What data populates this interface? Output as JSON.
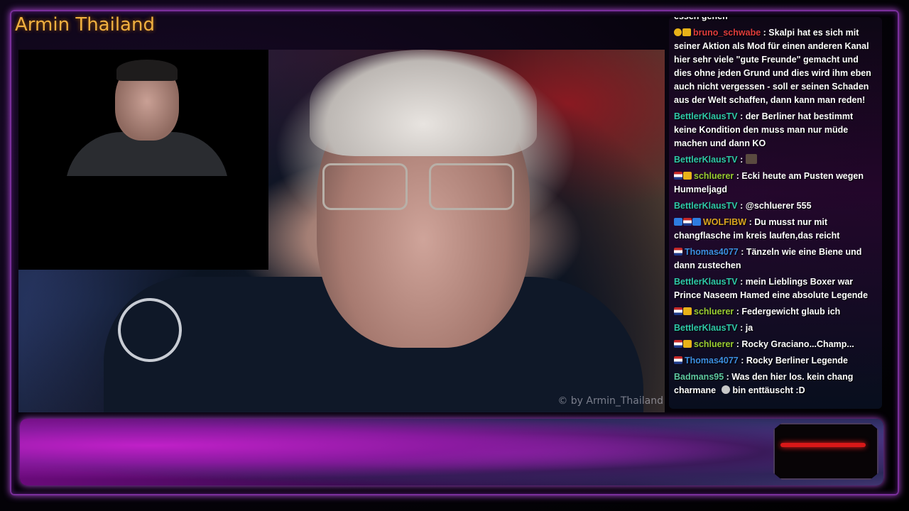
{
  "stream": {
    "title": "Armin Thailand",
    "watermark": "© by Armin_Thailand"
  },
  "colors": {
    "title": "#f0b040",
    "frame_border": "#7a2f9b"
  },
  "chat": {
    "partial_top": "essen gehen",
    "messages": [
      {
        "badges": [
          "warn-badge",
          "gold-badge"
        ],
        "user": "bruno_schwabe",
        "color": "#e03c3c",
        "text": ": Skalpi hat es sich mit seiner Aktion als Mod für einen anderen Kanal hier sehr viele \"gute Freunde\" gemacht und dies ohne jeden Grund und dies wird ihm eben auch nicht vergessen - soll er seinen Schaden aus der Welt schaffen, dann kann man reden!"
      },
      {
        "badges": [],
        "user": "BettlerKlausTV",
        "color": "#2fc9a8",
        "text": ": der Berliner hat bestimmt keine Kondition den muss man nur müde machen und dann KO"
      },
      {
        "badges": [],
        "user": "BettlerKlausTV",
        "color": "#2fc9a8",
        "text": ":",
        "emote": "emote-image"
      },
      {
        "badges": [
          "flag-badge",
          "gold-badge"
        ],
        "user": "schluerer",
        "color": "#9acd32",
        "text": ": Ecki heute am Pusten wegen Hummeljagd"
      },
      {
        "badges": [],
        "user": "BettlerKlausTV",
        "color": "#2fc9a8",
        "text": ": @schluerer 555"
      },
      {
        "badges": [
          "blue-badge",
          "flag-badge",
          "blue-badge"
        ],
        "user": "WOLFIBW",
        "color": "#daa520",
        "text": ": Du musst nur mit changflasche im kreis laufen,das reicht"
      },
      {
        "badges": [
          "flag-badge"
        ],
        "user": "Thomas4077",
        "color": "#3c8ee0",
        "text": ": Tänzeln wie eine Biene und dann zustechen"
      },
      {
        "badges": [],
        "user": "BettlerKlausTV",
        "color": "#2fc9a8",
        "text": ": mein Lieblings Boxer war Prince Naseem Hamed eine absolute Legende"
      },
      {
        "badges": [
          "flag-badge",
          "gold-badge"
        ],
        "user": "schluerer",
        "color": "#9acd32",
        "text": ": Federgewicht glaub ich"
      },
      {
        "badges": [],
        "user": "BettlerKlausTV",
        "color": "#2fc9a8",
        "text": ": ja"
      },
      {
        "badges": [
          "flag-badge",
          "gold-badge"
        ],
        "user": "schluerer",
        "color": "#9acd32",
        "text": ": Rocky Graciano...Champ..."
      },
      {
        "badges": [
          "flag-badge"
        ],
        "user": "Thomas4077",
        "color": "#3c8ee0",
        "text": ": Rocky Berliner Legende"
      },
      {
        "badges": [],
        "user": "Badmans95",
        "color": "#5ec8a0",
        "text": ": Was den hier los. kein chang charmane",
        "emote_small": "emote-small",
        "text_after": "bin enttäuscht :D"
      }
    ]
  }
}
